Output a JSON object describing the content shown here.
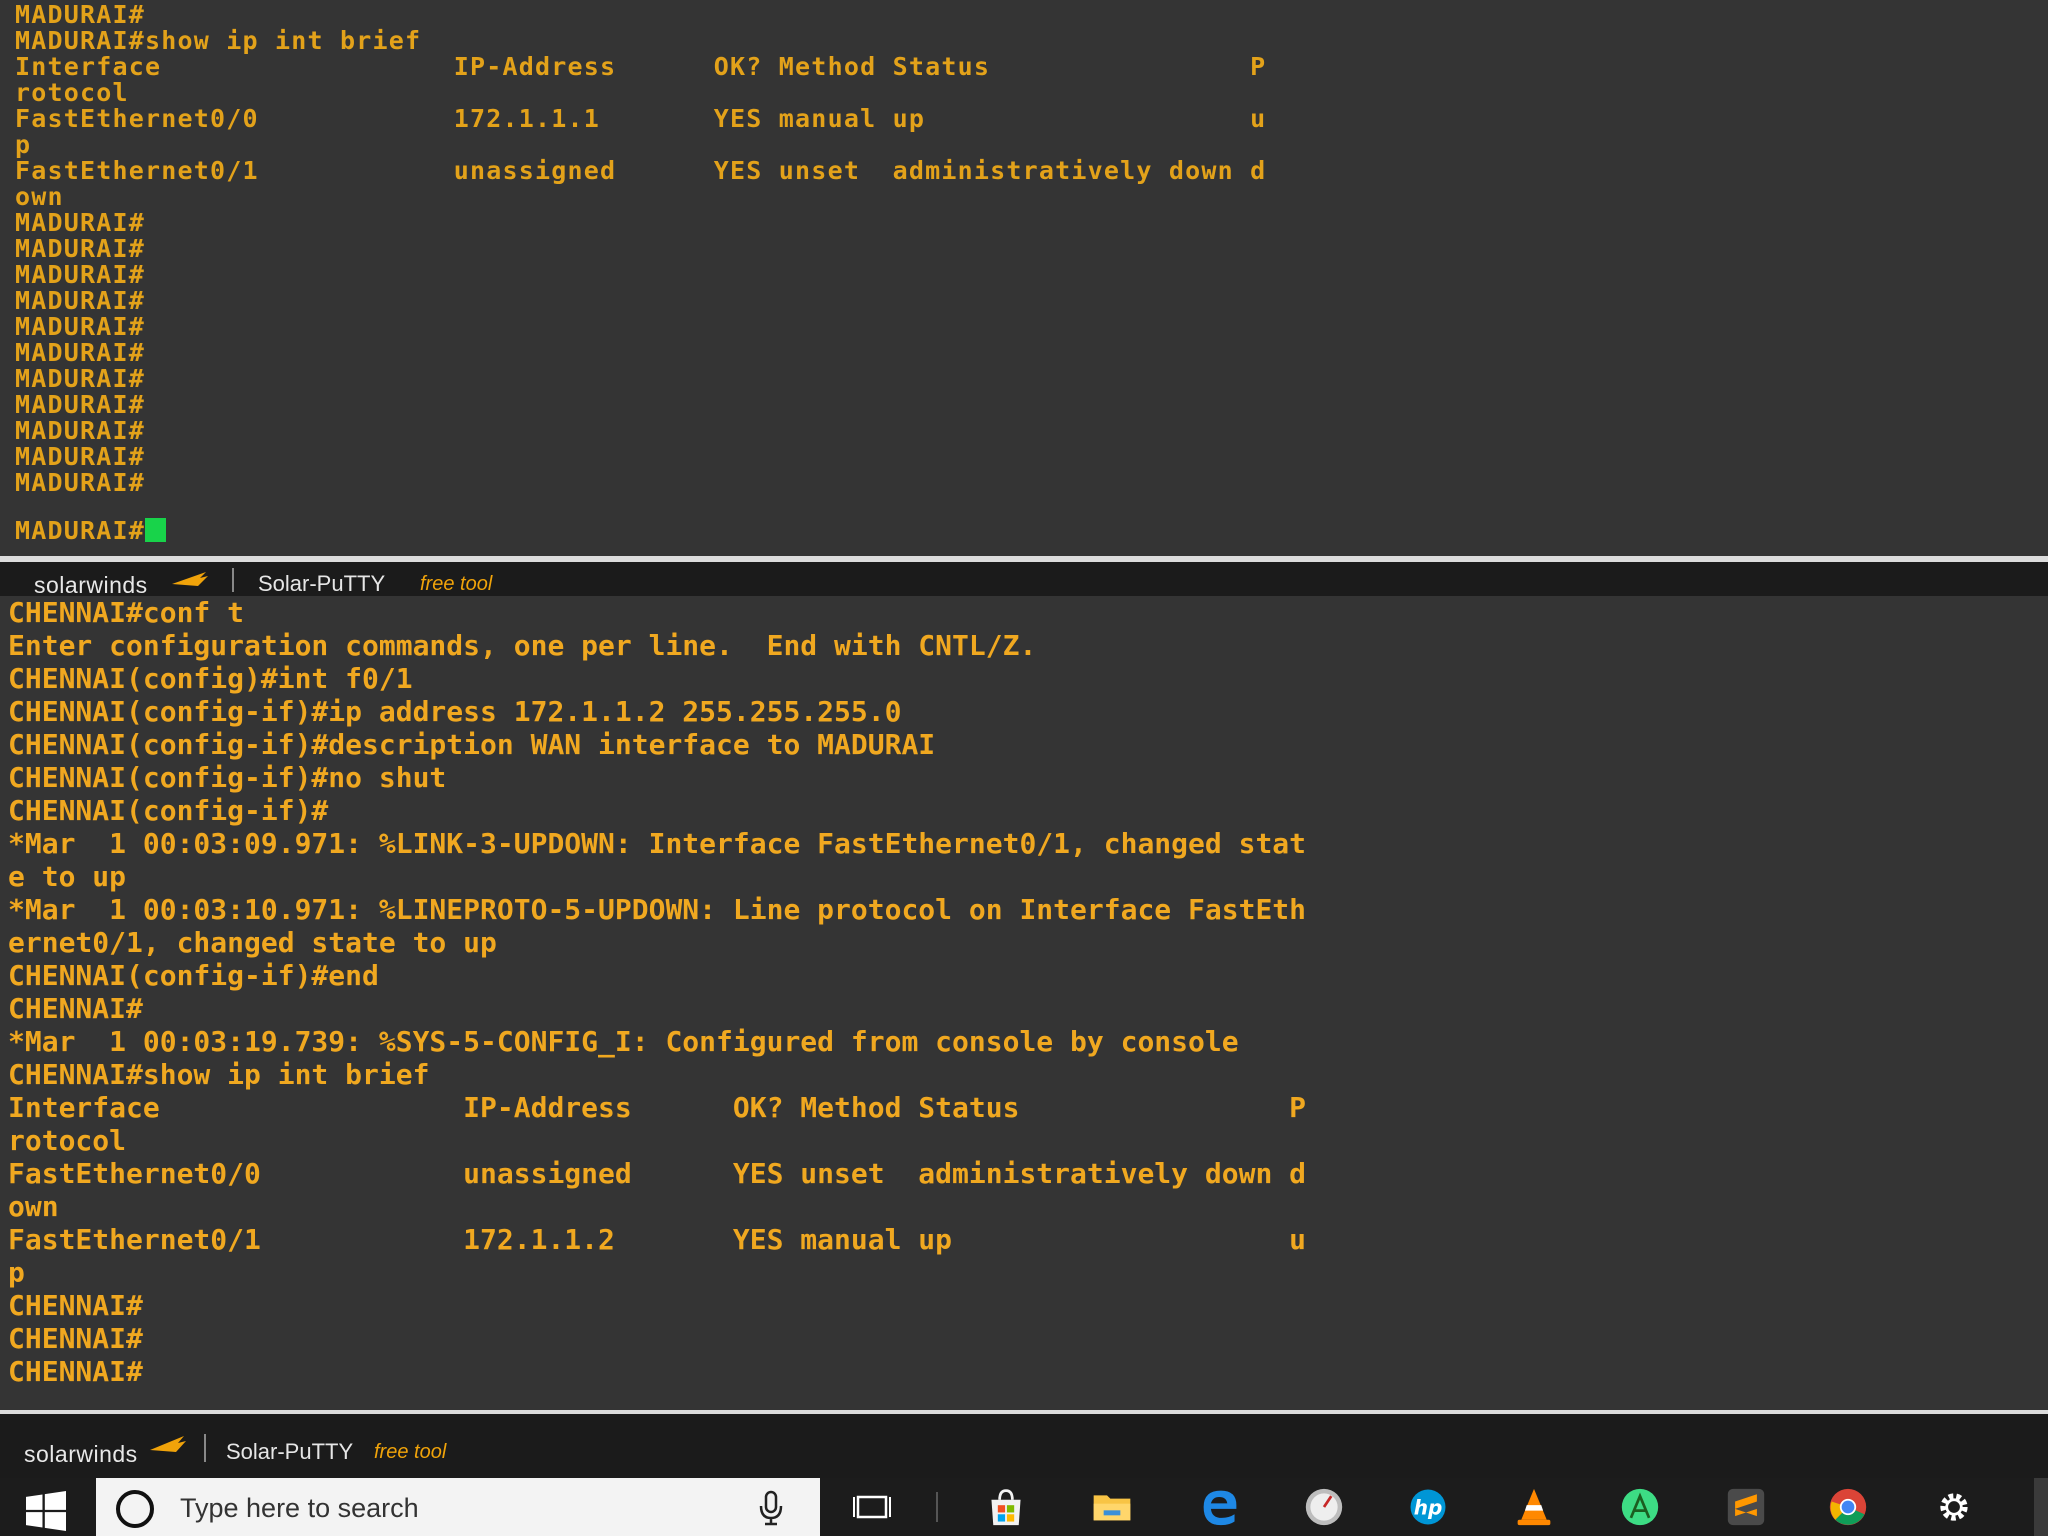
{
  "top_terminal": {
    "lines": [
      "MADURAI#",
      "MADURAI#show ip int brief",
      "Interface                  IP-Address      OK? Method Status                P",
      "rotocol",
      "FastEthernet0/0            172.1.1.1       YES manual up                    u",
      "p",
      "FastEthernet0/1            unassigned      YES unset  administratively down d",
      "own",
      "MADURAI#",
      "MADURAI#",
      "MADURAI#",
      "MADURAI#",
      "MADURAI#",
      "MADURAI#",
      "MADURAI#",
      "MADURAI#",
      "MADURAI#",
      "MADURAI#",
      "MADURAI#",
      "MADURAI#"
    ],
    "prompt": "MADURAI#"
  },
  "mid_brandbar": {
    "logo": "solarwinds",
    "app": "Solar-PuTTY",
    "free": "free tool"
  },
  "bottom_terminal": {
    "lines": [
      "CHENNAI#conf t",
      "Enter configuration commands, one per line.  End with CNTL/Z.",
      "CHENNAI(config)#int f0/1",
      "CHENNAI(config-if)#ip address 172.1.1.2 255.255.255.0",
      "CHENNAI(config-if)#description WAN interface to MADURAI",
      "CHENNAI(config-if)#no shut",
      "CHENNAI(config-if)#",
      "*Mar  1 00:03:09.971: %LINK-3-UPDOWN: Interface FastEthernet0/1, changed stat",
      "e to up",
      "*Mar  1 00:03:10.971: %LINEPROTO-5-UPDOWN: Line protocol on Interface FastEth",
      "ernet0/1, changed state to up",
      "CHENNAI(config-if)#end",
      "CHENNAI#",
      "*Mar  1 00:03:19.739: %SYS-5-CONFIG_I: Configured from console by console",
      "CHENNAI#show ip int brief",
      "Interface                  IP-Address      OK? Method Status                P",
      "rotocol",
      "FastEthernet0/0            unassigned      YES unset  administratively down d",
      "own",
      "FastEthernet0/1            172.1.1.2       YES manual up                    u",
      "p",
      "CHENNAI#",
      "CHENNAI#",
      "CHENNAI#"
    ]
  },
  "bottom_brandbar": {
    "logo": "solarwinds",
    "app": "Solar-PuTTY",
    "free": "free tool"
  },
  "taskbar": {
    "search_placeholder": "Type here to search"
  },
  "colors": {
    "terminal_text": "#f0a30a",
    "cursor": "#18d34a",
    "terminal_bg": "#343434"
  }
}
